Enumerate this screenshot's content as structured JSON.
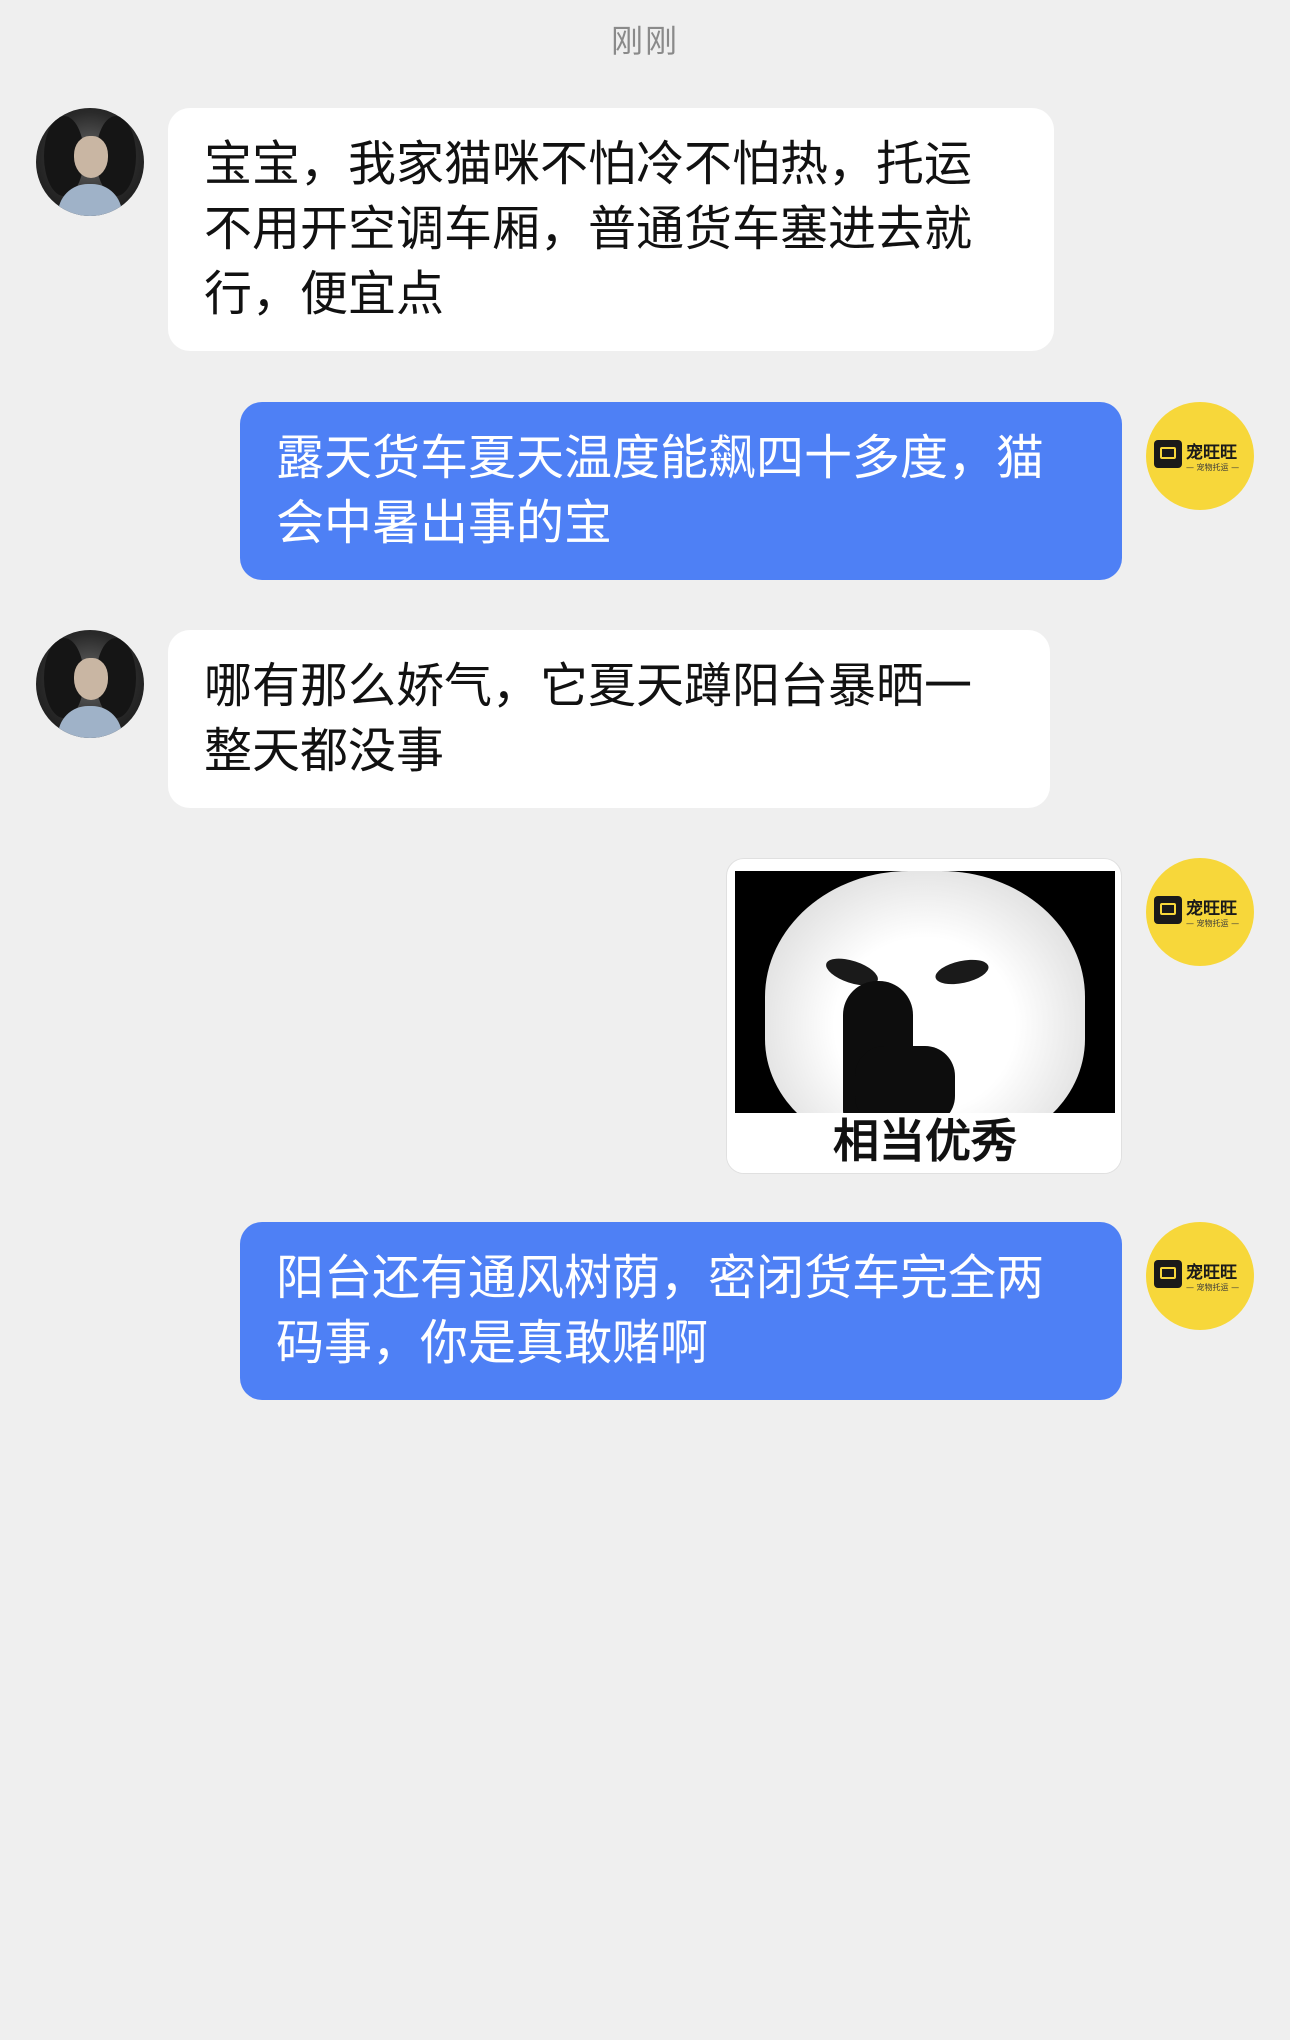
{
  "timestamp": "刚刚",
  "user": {
    "avatar_icon": "long-hair-dog-avatar-icon"
  },
  "service": {
    "avatar_icon": "pet-transport-logo-icon",
    "brand_name": "宠旺旺",
    "brand_sub": "— 宠物托运 —"
  },
  "messages": [
    {
      "from": "user",
      "text": "宝宝，我家猫咪不怕冷不怕热，托运不用开空调车厢，普通货车塞进去就行，便宜点"
    },
    {
      "from": "service",
      "text": "露天货车夏天温度能飙四十多度，猫会中暑出事的宝"
    },
    {
      "from": "user",
      "text": "哪有那么娇气，它夏天蹲阳台暴晒一整天都没事"
    },
    {
      "from": "service",
      "type": "sticker",
      "caption": "相当优秀"
    },
    {
      "from": "service",
      "text": "阳台还有通风树荫，密闭货车完全两码事，你是真敢赌啊"
    }
  ],
  "colors": {
    "background": "#efefef",
    "incoming_bubble": "#ffffff",
    "outgoing_bubble": "#4e80f5",
    "brand_yellow": "#f7d73a"
  }
}
